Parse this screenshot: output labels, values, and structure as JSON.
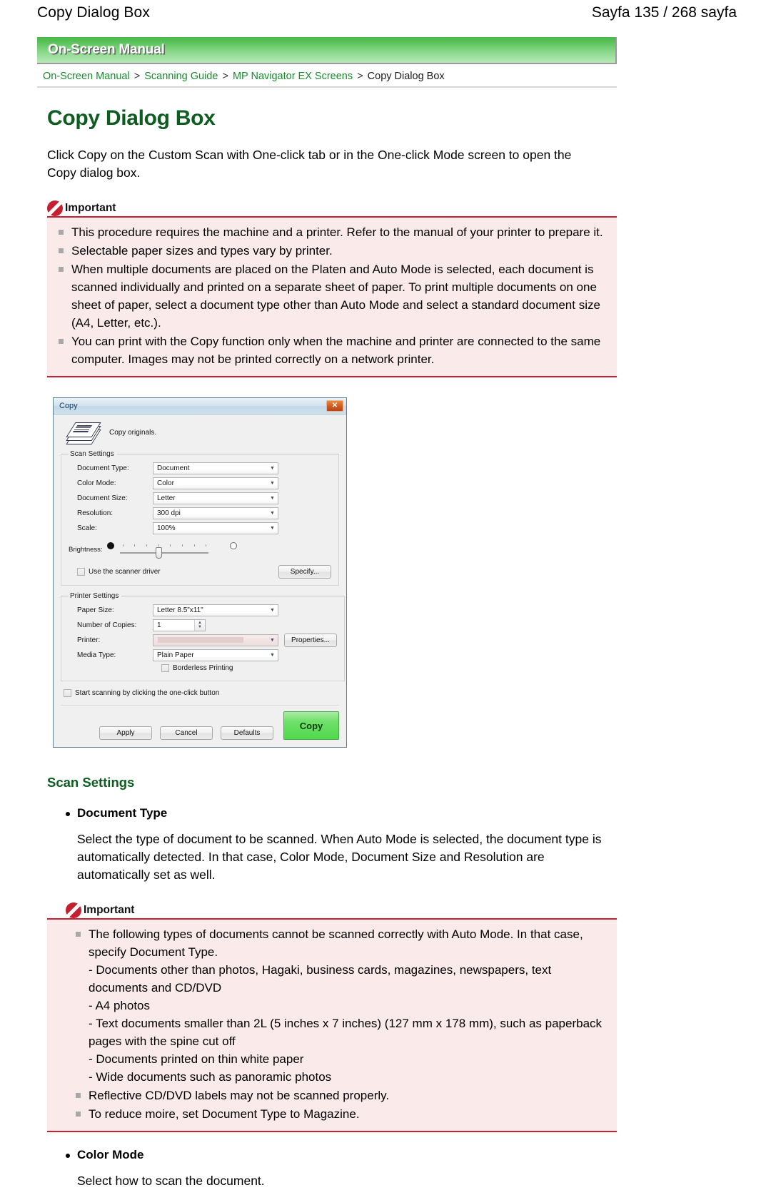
{
  "page_header": {
    "title": "Copy Dialog Box",
    "page_info": "Sayfa 135 / 268 sayfa"
  },
  "banner": {
    "label": "On-Screen Manual"
  },
  "breadcrumb": {
    "items": [
      {
        "label": "On-Screen Manual",
        "current": false
      },
      {
        "label": "Scanning Guide",
        "current": false
      },
      {
        "label": "MP Navigator EX Screens",
        "current": false
      },
      {
        "label": "Copy Dialog Box",
        "current": true
      }
    ],
    "separator": ">"
  },
  "doc": {
    "title": "Copy Dialog Box",
    "intro": "Click Copy on the Custom Scan with One-click tab or in the One-click Mode screen to open the Copy dialog box."
  },
  "important_1": {
    "label": "Important",
    "items": [
      "This procedure requires the machine and a printer. Refer to the manual of your printer to prepare it.",
      "Selectable paper sizes and types vary by printer.",
      "When multiple documents are placed on the Platen and Auto Mode is selected, each document is scanned individually and printed on a separate sheet of paper. To print multiple documents on one sheet of paper, select a document type other than Auto Mode and select a standard document size (A4, Letter, etc.).",
      "You can print with the Copy function only when the machine and printer are connected to the same computer. Images may not be printed correctly on a network printer."
    ]
  },
  "dialog": {
    "title": "Copy",
    "close_label": "✕",
    "intro_text": "Copy originals.",
    "scan_settings": {
      "legend": "Scan Settings",
      "rows": [
        {
          "label": "Document Type:",
          "value": "Document"
        },
        {
          "label": "Color Mode:",
          "value": "Color"
        },
        {
          "label": "Document Size:",
          "value": "Letter"
        },
        {
          "label": "Resolution:",
          "value": "300 dpi"
        },
        {
          "label": "Scale:",
          "value": "100%"
        }
      ],
      "brightness_label": "Brightness:",
      "use_driver_label": "Use the scanner driver",
      "specify_button": "Specify..."
    },
    "printer_settings": {
      "legend": "Printer Settings",
      "paper_size_label": "Paper Size:",
      "paper_size_value": "Letter 8.5\"x11\"",
      "copies_label": "Number of Copies:",
      "copies_value": "1",
      "printer_label": "Printer:",
      "printer_value": "",
      "properties_button": "Properties...",
      "media_type_label": "Media Type:",
      "media_type_value": "Plain Paper",
      "borderless_label": "Borderless Printing"
    },
    "oneclick_label": "Start scanning by clicking the one-click button",
    "buttons": {
      "apply": "Apply",
      "cancel": "Cancel",
      "defaults": "Defaults",
      "copy": "Copy"
    }
  },
  "scan_settings_section": {
    "title": "Scan Settings",
    "document_type": {
      "heading": "Document Type",
      "body": "Select the type of document to be scanned. When Auto Mode is selected, the document type is automatically detected. In that case, Color Mode, Document Size and Resolution are automatically set as well."
    },
    "color_mode": {
      "heading": "Color Mode",
      "body": "Select how to scan the document."
    }
  },
  "important_2": {
    "label": "Important",
    "items": [
      "The following types of documents cannot be scanned correctly with Auto Mode. In that case, specify Document Type.\n- Documents other than photos, Hagaki, business cards, magazines, newspapers, text documents and CD/DVD\n- A4 photos\n- Text documents smaller than 2L (5 inches x 7 inches) (127 mm x 178 mm), such as paperback pages with the spine cut off\n- Documents printed on thin white paper\n- Wide documents such as panoramic photos",
      "Reflective CD/DVD labels may not be scanned properly.",
      "To reduce moire, set Document Type to Magazine."
    ]
  },
  "colors": {
    "green_accent": "#0d5c20",
    "banner_green": "#49b849",
    "important_red": "#c4202f",
    "callout_bg": "#fbeaea",
    "link_green": "#1a8a2e",
    "copy_button_green": "#4fd94a"
  }
}
